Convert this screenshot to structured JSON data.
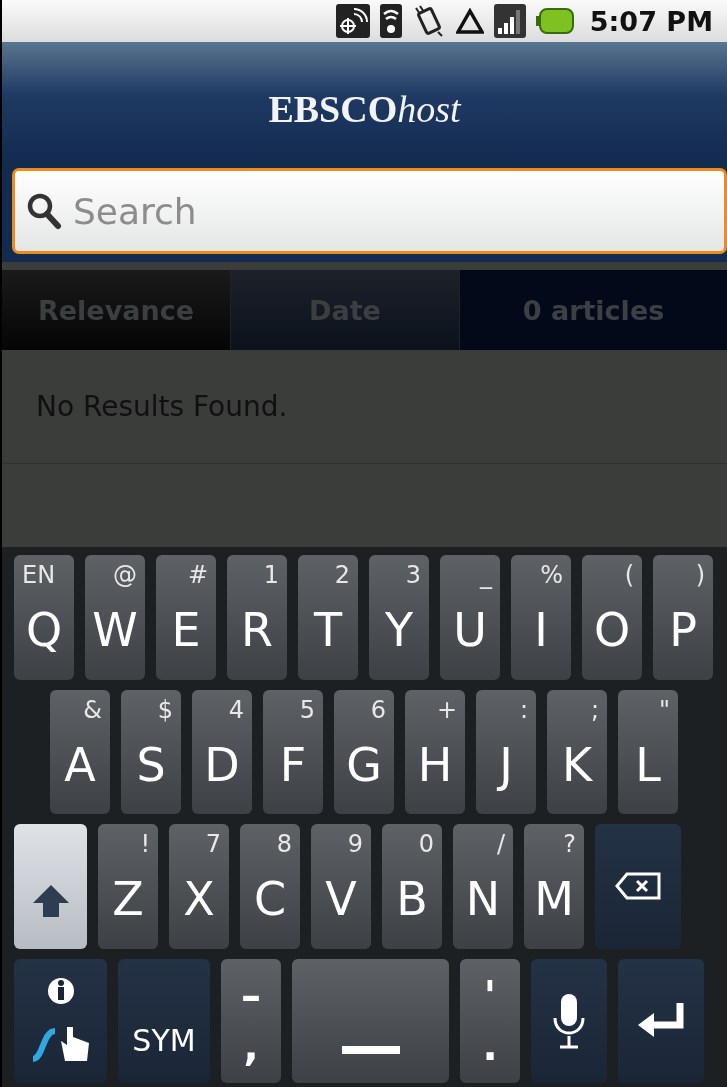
{
  "status_bar": {
    "time": "5:07 PM"
  },
  "header": {
    "logo_bold": "EBSCO",
    "logo_italic": "host"
  },
  "search": {
    "placeholder": "Search"
  },
  "sort_tabs": [
    {
      "label": "Relevance",
      "selected": true
    },
    {
      "label": "Date",
      "selected": false
    }
  ],
  "result_count": "0 articles",
  "message": "No Results Found.",
  "keyboard": {
    "key_rows": [
      {
        "keys": [
          {
            "kind": "lang",
            "main": "Q",
            "alt": "EN"
          },
          {
            "kind": "char",
            "main": "W",
            "alt": "@"
          },
          {
            "kind": "char",
            "main": "E",
            "alt": "#"
          },
          {
            "kind": "char",
            "main": "R",
            "alt": "1"
          },
          {
            "kind": "char",
            "main": "T",
            "alt": "2"
          },
          {
            "kind": "char",
            "main": "Y",
            "alt": "3"
          },
          {
            "kind": "char",
            "main": "U",
            "alt": "_"
          },
          {
            "kind": "char",
            "main": "I",
            "alt": "%"
          },
          {
            "kind": "char",
            "main": "O",
            "alt": "("
          },
          {
            "kind": "char",
            "main": "P",
            "alt": ")"
          }
        ]
      },
      {
        "keys": [
          {
            "kind": "char",
            "main": "A",
            "alt": "&"
          },
          {
            "kind": "char",
            "main": "S",
            "alt": "$"
          },
          {
            "kind": "char",
            "main": "D",
            "alt": "4"
          },
          {
            "kind": "char",
            "main": "F",
            "alt": "5"
          },
          {
            "kind": "char",
            "main": "G",
            "alt": "6"
          },
          {
            "kind": "char",
            "main": "H",
            "alt": "+"
          },
          {
            "kind": "char",
            "main": "J",
            "alt": ":"
          },
          {
            "kind": "char",
            "main": "K",
            "alt": ";"
          },
          {
            "kind": "char",
            "main": "L",
            "alt": "\""
          }
        ]
      },
      {
        "keys": [
          {
            "kind": "shift",
            "on": true
          },
          {
            "kind": "char",
            "main": "Z",
            "alt": "!"
          },
          {
            "kind": "char",
            "main": "X",
            "alt": "7"
          },
          {
            "kind": "char",
            "main": "C",
            "alt": "8"
          },
          {
            "kind": "char",
            "main": "V",
            "alt": "9"
          },
          {
            "kind": "char",
            "main": "B",
            "alt": "0"
          },
          {
            "kind": "char",
            "main": "N",
            "alt": "/"
          },
          {
            "kind": "char",
            "main": "M",
            "alt": "?"
          },
          {
            "kind": "backspace"
          }
        ]
      },
      {
        "keys": [
          {
            "kind": "swype"
          },
          {
            "kind": "label",
            "main": "SYM"
          },
          {
            "kind": "punct",
            "main": ",",
            "alt": "–"
          },
          {
            "kind": "space"
          },
          {
            "kind": "punct",
            "main": ".",
            "alt": "'"
          },
          {
            "kind": "mic"
          },
          {
            "kind": "enter"
          }
        ]
      }
    ]
  }
}
